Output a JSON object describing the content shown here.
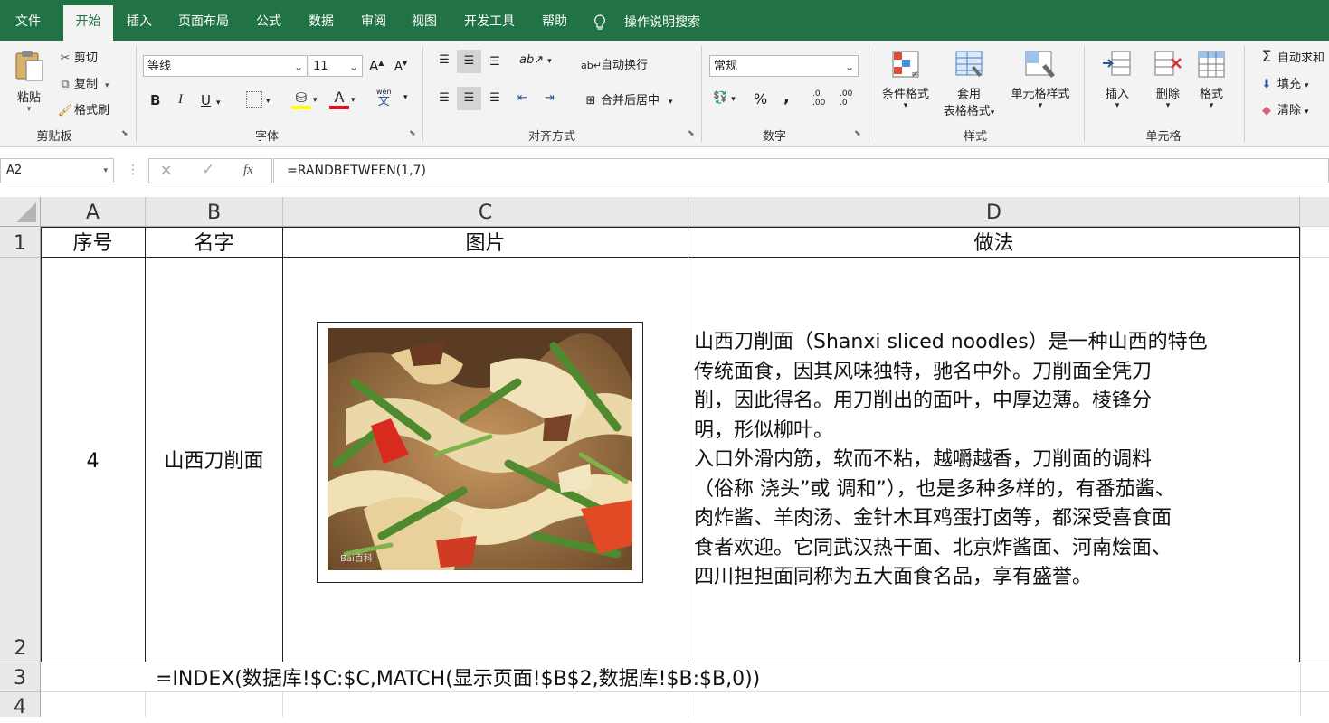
{
  "tabs": {
    "file": "文件",
    "home": "开始",
    "insert": "插入",
    "page_layout": "页面布局",
    "formulas": "公式",
    "data": "数据",
    "review": "审阅",
    "view": "视图",
    "developer": "开发工具",
    "help": "帮助",
    "tell_me": "操作说明搜索"
  },
  "clipboard": {
    "paste": "粘贴",
    "cut": "剪切",
    "copy": "复制",
    "format_painter": "格式刷",
    "group": "剪贴板"
  },
  "font": {
    "name": "等线",
    "size": "11",
    "bold": "B",
    "italic": "I",
    "underline": "U",
    "grow": "A",
    "shrink": "A",
    "font_color_glyph": "A",
    "phonetic_top": "wén",
    "phonetic_bottom": "文",
    "group": "字体"
  },
  "alignment": {
    "wrap_text": "自动换行",
    "merge_center": "合并后居中",
    "group": "对齐方式"
  },
  "number": {
    "format": "常规",
    "percent": "%",
    "comma": ",",
    "inc_dec_top": ".0",
    "inc_dec_bottom": ".00",
    "dec_dec_top": ".00",
    "dec_dec_bottom": ".0",
    "group": "数字"
  },
  "styles": {
    "conditional": "条件格式",
    "table_line1": "套用",
    "table_line2": "表格格式",
    "cell_styles": "单元格样式",
    "group": "样式"
  },
  "cells": {
    "insert": "插入",
    "delete": "删除",
    "format": "格式",
    "group": "单元格"
  },
  "editing": {
    "autosum": "自动求和",
    "fill": "填充",
    "clear": "清除"
  },
  "formula_bar": {
    "name_box": "A2",
    "formula": "=RANDBETWEEN(1,7)",
    "fx": "fx"
  },
  "columns": [
    "A",
    "B",
    "C",
    "D"
  ],
  "rows": [
    "1",
    "2",
    "3",
    "4"
  ],
  "sheet": {
    "header": {
      "a": "序号",
      "b": "名字",
      "c": "图片",
      "d": "做法"
    },
    "row2": {
      "a": "4",
      "b": "山西刀削面",
      "d_lines": [
        "山西刀削面（Shanxi sliced noodles）是一种山西的特色",
        "传统面食，因其风味独特，驰名中外。刀削面全凭刀",
        "削，因此得名。用刀削出的面叶，中厚边薄。棱锋分",
        "明，形似柳叶。",
        "入口外滑内筋，软而不粘，越嚼越香，刀削面的调料",
        "（俗称 浇头”或 调和”），也是多种多样的，有番茄酱、",
        "肉炸酱、羊肉汤、金针木耳鸡蛋打卤等，都深受喜食面",
        "食者欢迎。它同武汉热干面、北京炸酱面、河南烩面、",
        "四川担担面同称为五大面食名品，享有盛誉。"
      ],
      "photo_watermark": "Bai百科"
    },
    "row3": {
      "b": "=INDEX(数据库!$C:$C,MATCH(显示页面!$B$2,数据库!$B:$B,0))"
    }
  }
}
